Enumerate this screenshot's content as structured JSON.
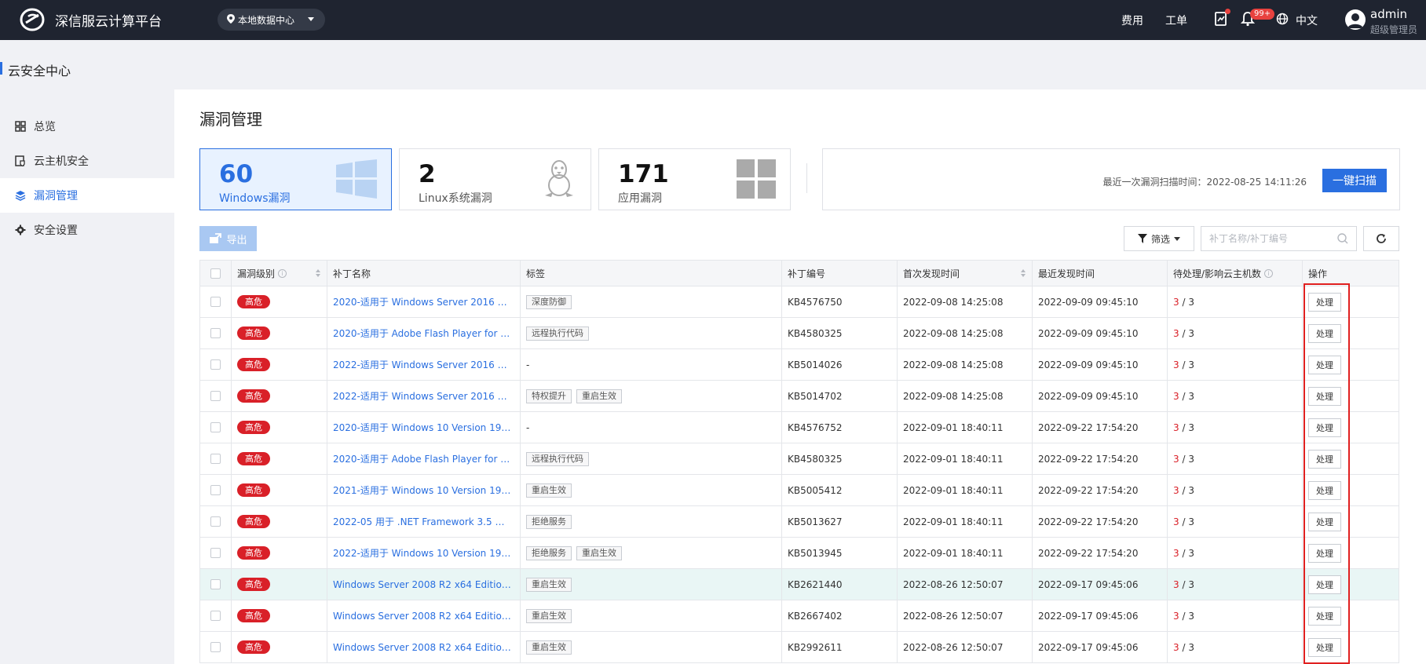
{
  "topbar": {
    "brand": "深信服云计算平台",
    "region": "本地数据中心",
    "links": [
      "费用",
      "工单"
    ],
    "notification_badge": "99+",
    "language": "中文",
    "user_name": "admin",
    "user_role": "超级管理员"
  },
  "subheader": {
    "title": "云安全中心"
  },
  "sidebar": {
    "items": [
      {
        "label": "总览",
        "icon": "grid-icon"
      },
      {
        "label": "云主机安全",
        "icon": "host-shield-icon"
      },
      {
        "label": "漏洞管理",
        "icon": "layers-icon"
      },
      {
        "label": "安全设置",
        "icon": "gear-icon"
      }
    ],
    "active": "漏洞管理"
  },
  "main": {
    "title": "漏洞管理",
    "cards": [
      {
        "count": "60",
        "label": "Windows漏洞",
        "icon": "windows-icon"
      },
      {
        "count": "2",
        "label": "Linux系统漏洞",
        "icon": "linux-icon"
      },
      {
        "count": "171",
        "label": "应用漏洞",
        "icon": "apps-icon"
      }
    ],
    "scan_time": "最近一次漏洞扫描时间：2022-08-25 14:11:26",
    "scan_button": "一键扫描",
    "export_label": "导出",
    "filter_label": "筛选",
    "search_placeholder": "补丁名称/补丁编号"
  },
  "table": {
    "columns": [
      "漏洞级别",
      "补丁名称",
      "标签",
      "补丁编号",
      "首次发现时间",
      "最近发现时间",
      "待处理/影响云主机数",
      "操作"
    ],
    "rows": [
      {
        "level": "高危",
        "name": "2020-适用于 Windows Server 2016 的 ...",
        "tags": [
          "深度防御"
        ],
        "kb": "KB4576750",
        "first": "2022-09-08 14:25:08",
        "last": "2022-09-09 09:45:10",
        "pending": "3",
        "total": "/ 3",
        "action": "处理"
      },
      {
        "level": "高危",
        "name": "2020-适用于 Adobe Flash Player for W...",
        "tags": [
          "远程执行代码"
        ],
        "kb": "KB4580325",
        "first": "2022-09-08 14:25:08",
        "last": "2022-09-09 09:45:10",
        "pending": "3",
        "total": "/ 3",
        "action": "处理"
      },
      {
        "level": "高危",
        "name": "2022-适用于 Windows Server 2016 的 ...",
        "tags": [],
        "tags_empty": "-",
        "kb": "KB5014026",
        "first": "2022-09-08 14:25:08",
        "last": "2022-09-09 09:45:10",
        "pending": "3",
        "total": "/ 3",
        "action": "处理"
      },
      {
        "level": "高危",
        "name": "2022-适用于 Windows Server 2016 的 ...",
        "tags": [
          "特权提升",
          "重启生效"
        ],
        "kb": "KB5014702",
        "first": "2022-09-08 14:25:08",
        "last": "2022-09-09 09:45:10",
        "pending": "3",
        "total": "/ 3",
        "action": "处理"
      },
      {
        "level": "高危",
        "name": "2020-适用于 Windows 10 Version 190...",
        "tags": [],
        "tags_empty": "-",
        "kb": "KB4576752",
        "first": "2022-09-01 18:40:11",
        "last": "2022-09-22 17:54:20",
        "pending": "3",
        "total": "/ 3",
        "action": "处理"
      },
      {
        "level": "高危",
        "name": "2020-适用于 Adobe Flash Player for W...",
        "tags": [
          "远程执行代码"
        ],
        "kb": "KB4580325",
        "first": "2022-09-01 18:40:11",
        "last": "2022-09-22 17:54:20",
        "pending": "3",
        "total": "/ 3",
        "action": "处理"
      },
      {
        "level": "高危",
        "name": "2021-适用于 Windows 10 Version 190...",
        "tags": [
          "重启生效"
        ],
        "kb": "KB5005412",
        "first": "2022-09-01 18:40:11",
        "last": "2022-09-22 17:54:20",
        "pending": "3",
        "total": "/ 3",
        "action": "处理"
      },
      {
        "level": "高危",
        "name": "2022-05 用于 .NET Framework 3.5 和 4...",
        "tags": [
          "拒绝服务"
        ],
        "kb": "KB5013627",
        "first": "2022-09-01 18:40:11",
        "last": "2022-09-22 17:54:20",
        "pending": "3",
        "total": "/ 3",
        "action": "处理"
      },
      {
        "level": "高危",
        "name": "2022-适用于 Windows 10 Version 190...",
        "tags": [
          "拒绝服务",
          "重启生效"
        ],
        "kb": "KB5013945",
        "first": "2022-09-01 18:40:11",
        "last": "2022-09-22 17:54:20",
        "pending": "3",
        "total": "/ 3",
        "action": "处理"
      },
      {
        "level": "高危",
        "name": "Windows Server 2008 R2 x64 Edition ...",
        "tags": [
          "重启生效"
        ],
        "kb": "KB2621440",
        "first": "2022-08-26 12:50:07",
        "last": "2022-09-17 09:45:06",
        "pending": "3",
        "total": "/ 3",
        "action": "处理"
      },
      {
        "level": "高危",
        "name": "Windows Server 2008 R2 x64 Edition ...",
        "tags": [
          "重启生效"
        ],
        "kb": "KB2667402",
        "first": "2022-08-26 12:50:07",
        "last": "2022-09-17 09:45:06",
        "pending": "3",
        "total": "/ 3",
        "action": "处理"
      },
      {
        "level": "高危",
        "name": "Windows Server 2008 R2 x64 Edition ...",
        "tags": [
          "重启生效"
        ],
        "kb": "KB2992611",
        "first": "2022-08-26 12:50:07",
        "last": "2022-09-17 09:45:06",
        "pending": "3",
        "total": "/ 3",
        "action": "处理"
      }
    ]
  },
  "colors": {
    "topbar": "#1f2430",
    "accent": "#2a6fe0",
    "danger": "#d92028",
    "highlight_row": "#e9f6f5",
    "annotation_box": "#e02020"
  }
}
